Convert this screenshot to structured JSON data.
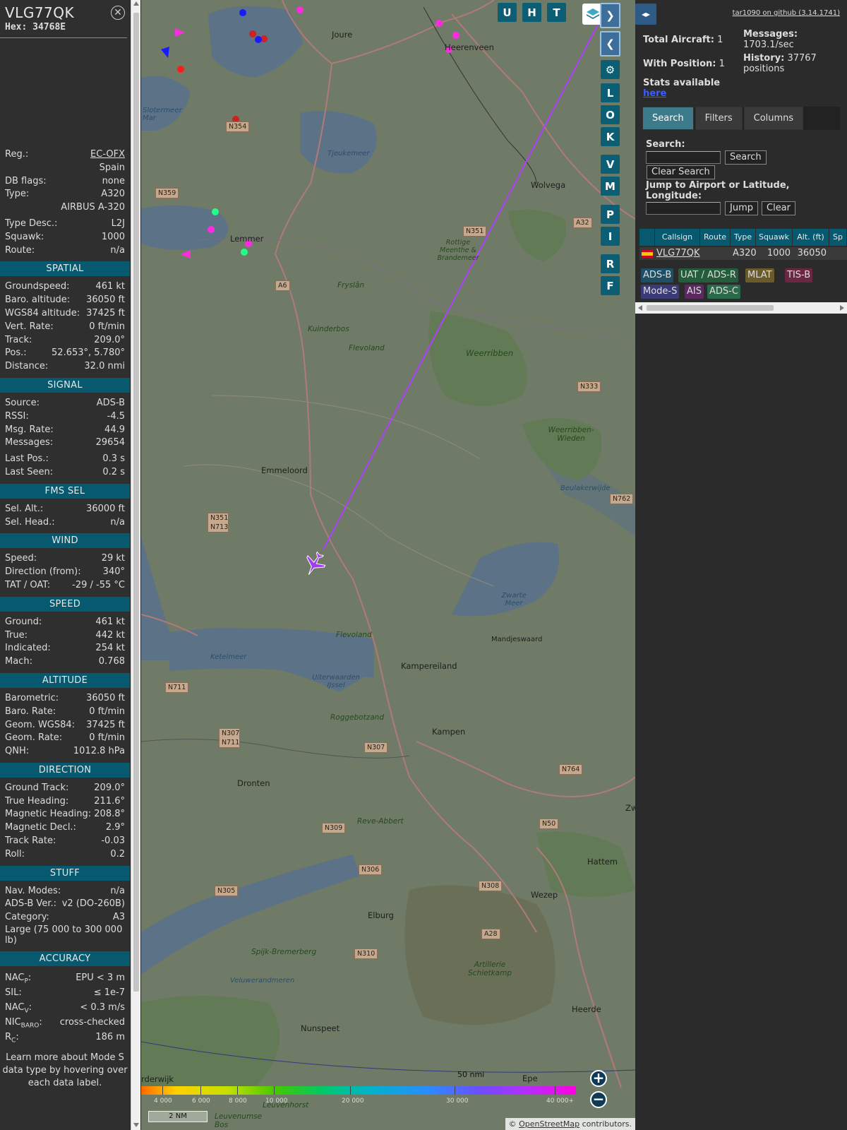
{
  "selected": {
    "callsign": "VLG77QK",
    "hex_label": "Hex:",
    "hex": "34768E",
    "close_icon": "close-circle-icon"
  },
  "info": {
    "identity": [
      {
        "label": "Reg.:",
        "value": "EC-OFX"
      },
      {
        "label": "",
        "value": "Spain"
      },
      {
        "label": "DB flags:",
        "value": "none"
      },
      {
        "label": "Type:",
        "value": "A320"
      },
      {
        "label": "",
        "value": "AIRBUS A-320"
      },
      {
        "label": "Type Desc.:",
        "value": "L2J"
      },
      {
        "label": "Squawk:",
        "value": "1000"
      },
      {
        "label": "Route:",
        "value": "n/a"
      }
    ],
    "sections": {
      "spatial": {
        "title": "SPATIAL",
        "rows": [
          {
            "label": "Groundspeed:",
            "value": "461 kt"
          },
          {
            "label": "Baro. altitude:",
            "value": "36050 ft"
          },
          {
            "label": "WGS84 altitude:",
            "value": "37425 ft"
          },
          {
            "label": "Vert. Rate:",
            "value": "0 ft/min"
          },
          {
            "label": "Track:",
            "value": "209.0°"
          },
          {
            "label": "Pos.:",
            "value": "52.653°, 5.780°"
          },
          {
            "label": "Distance:",
            "value": "32.0 nmi"
          }
        ]
      },
      "signal": {
        "title": "SIGNAL",
        "rows": [
          {
            "label": "Source:",
            "value": "ADS-B"
          },
          {
            "label": "RSSI:",
            "value": "-4.5"
          },
          {
            "label": "Msg. Rate:",
            "value": "44.9"
          },
          {
            "label": "Messages:",
            "value": "29654"
          },
          {
            "label": "Last Pos.:",
            "value": "0.3 s"
          },
          {
            "label": "Last Seen:",
            "value": "0.2 s"
          }
        ]
      },
      "fms": {
        "title": "FMS SEL",
        "rows": [
          {
            "label": "Sel. Alt.:",
            "value": "36000 ft"
          },
          {
            "label": "Sel. Head.:",
            "value": "n/a"
          }
        ]
      },
      "wind": {
        "title": "WIND",
        "rows": [
          {
            "label": "Speed:",
            "value": "29 kt"
          },
          {
            "label": "Direction (from):",
            "value": "340°"
          },
          {
            "label": "TAT / OAT:",
            "value": "-29 / -55 °C"
          }
        ]
      },
      "speed": {
        "title": "SPEED",
        "rows": [
          {
            "label": "Ground:",
            "value": "461 kt"
          },
          {
            "label": "True:",
            "value": "442 kt"
          },
          {
            "label": "Indicated:",
            "value": "254 kt"
          },
          {
            "label": "Mach:",
            "value": "0.768"
          }
        ]
      },
      "altitude": {
        "title": "ALTITUDE",
        "rows": [
          {
            "label": "Barometric:",
            "value": "36050 ft"
          },
          {
            "label": "Baro. Rate:",
            "value": "0 ft/min"
          },
          {
            "label": "Geom. WGS84:",
            "value": "37425 ft"
          },
          {
            "label": "Geom. Rate:",
            "value": "0 ft/min"
          },
          {
            "label": "QNH:",
            "value": "1012.8 hPa"
          }
        ]
      },
      "direction": {
        "title": "DIRECTION",
        "rows": [
          {
            "label": "Ground Track:",
            "value": "209.0°"
          },
          {
            "label": "True Heading:",
            "value": "211.6°"
          },
          {
            "label": "Magnetic Heading:",
            "value": "208.8°"
          },
          {
            "label": "Magnetic Decl.:",
            "value": "2.9°"
          },
          {
            "label": "Track Rate:",
            "value": "-0.03"
          },
          {
            "label": "Roll:",
            "value": "0.2"
          }
        ]
      },
      "stuff": {
        "title": "STUFF",
        "rows": [
          {
            "label": "Nav. Modes:",
            "value": "n/a"
          },
          {
            "label": "ADS-B Ver.:",
            "value": "v2 (DO-260B)"
          },
          {
            "label": "Category:",
            "value": "A3"
          }
        ],
        "category_text": "Large (75 000 to 300 000 lb)"
      },
      "accuracy": {
        "title": "ACCURACY",
        "nacp_label": "NAC",
        "nacp_sub": "P",
        "nacp_value": "EPU < 3 m",
        "sil_label": "SIL:",
        "sil_value": "≤ 1e-7",
        "nacv_label": "NAC",
        "nacv_sub": "V",
        "nacv_value": "< 0.3 m/s",
        "nicbaro_label": "NIC",
        "nicbaro_sub": "BARO",
        "nicbaro_value": "cross-checked",
        "rc_label": "R",
        "rc_sub": "C",
        "rc_value": "186 m"
      }
    },
    "learn_more": "Learn more about Mode S data type by hovering over each data label."
  },
  "map": {
    "buttons": {
      "u": "U",
      "h": "H",
      "t": "T",
      "l": "L",
      "o": "O",
      "k": "K",
      "v": "V",
      "m": "M",
      "p": "P",
      "i": "I",
      "r": "R",
      "f": "F"
    },
    "labels": {
      "joure": "Joure",
      "heerenveen": "Heerenveen",
      "wolvega": "Wolvega",
      "lemmer": "Lemmer",
      "emmeloord": "Emmeloord",
      "dronten": "Dronten",
      "kampen": "Kampen",
      "kampereiland": "Kampereiland",
      "mandjeswaard": "Mandjeswaard",
      "elburg": "Elburg",
      "wezep": "Wezep",
      "hattem": "Hattem",
      "heerde": "Heerde",
      "nunspeet": "Nunspeet",
      "epe": "Epe",
      "zw": "Zw",
      "tjeukemeer": "Tjeukemeer",
      "sloten": "Slotermeer Mar",
      "ketelmeer": "Ketelmeer",
      "uiterwaarden": "Uiterwaarden IJssel",
      "veluwerandmeren": "Veluwerandmeren",
      "weerribben": "Weerribben",
      "weerribben_wieden": "Weerribben-Wieden",
      "zwarte_meer": "Zwarte Meer",
      "beulakerwijde": "Beulakerwijde",
      "kuinderbos": "Kuinderbos",
      "flevoland": "Flevoland",
      "rottige": "Rottige Meenthe & Brandemeer",
      "artillerie": "Artillerie Schietkamp",
      "fryslan": "Fryslân",
      "raggebotzand": "Roggebotzand",
      "reve": "Reve-Abbert",
      "spijk": "Spijk-Bremerberg",
      "harderwijk": "rderwijk",
      "leuvenum": "Leuvenumse Bos",
      "hoorst": "Leuvenhorst"
    },
    "shields": {
      "n354": "N354",
      "n359": "N359",
      "n351": "N351",
      "a32": "A32",
      "a6": "A6",
      "n333": "N333",
      "n762": "N762",
      "n351_713": "N351 N713",
      "n711": "N711",
      "n307_711": "N307 N711",
      "n307": "N307",
      "n764": "N764",
      "n50": "N50",
      "n309": "N309",
      "n306": "N306",
      "n308": "N308",
      "n305": "N305",
      "a28": "A28",
      "n310": "N310"
    },
    "colorbar_labels": [
      "4 000",
      "6 000",
      "8 000",
      "10 000",
      "20 000",
      "30 000",
      "40 000+"
    ],
    "scale_text": "2 NM",
    "scale_nmi": "50 nmi",
    "attribution_prefix": "© ",
    "attribution_link": "OpenStreetMap",
    "attribution_suffix": " contributors.",
    "aircraft_color": "#a43cf0",
    "track_color": "#b040ff"
  },
  "sidebar": {
    "version": "tar1090 on github (3.14.1741)",
    "total_aircraft_label": "Total Aircraft:",
    "total_aircraft": "1",
    "with_position_label": "With Position:",
    "with_position": "1",
    "messages_label": "Messages:",
    "messages": "1703.1/sec",
    "history_label": "History:",
    "history": "37767 positions",
    "stats_label": "Stats available",
    "stats_link": "here",
    "tabs": [
      "Search",
      "Filters",
      "Columns"
    ],
    "search_label": "Search:",
    "search_value": "",
    "search_button": "Search",
    "clear_search_button": "Clear Search",
    "jump_label": "Jump to Airport or Latitude, Longitude:",
    "jump_value": "",
    "jump_button": "Jump",
    "clear_button": "Clear",
    "table_headers": [
      "",
      "Callsign",
      "Route",
      "Type",
      "Squawk",
      "Alt. (ft)",
      "Sp"
    ],
    "table_rows": [
      {
        "flag": "spain-flag-icon",
        "callsign": "VLG77QK",
        "route": "",
        "type": "A320",
        "squawk": "1000",
        "alt": "36050",
        "sp": ""
      }
    ],
    "sources": [
      {
        "label": "ADS-B",
        "bg": "#1f4f66"
      },
      {
        "label": "UAT / ADS-R",
        "bg": "#245c3c"
      },
      {
        "label": "MLAT",
        "bg": "#6b5a2a"
      },
      {
        "label": "TIS-B",
        "bg": "#6b2742"
      },
      {
        "label": "Mode-S",
        "bg": "#3b3a78"
      },
      {
        "label": "AIS",
        "bg": "#5a2a5e"
      },
      {
        "label": "ADS-C",
        "bg": "#2a6a4a"
      }
    ]
  }
}
